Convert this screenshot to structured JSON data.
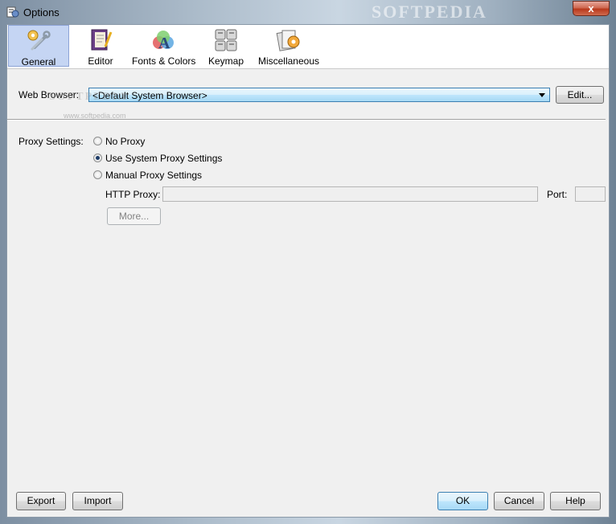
{
  "window": {
    "title": "Options",
    "close_label": "x",
    "watermark": "SOFTPEDIA",
    "watermark_url": "www.softpedia.com"
  },
  "toolbar": {
    "tabs": [
      {
        "label": "General",
        "icon": "general-icon",
        "selected": true
      },
      {
        "label": "Editor",
        "icon": "editor-icon",
        "selected": false
      },
      {
        "label": "Fonts & Colors",
        "icon": "fonts-colors-icon",
        "selected": false
      },
      {
        "label": "Keymap",
        "icon": "keymap-icon",
        "selected": false
      },
      {
        "label": "Miscellaneous",
        "icon": "miscellaneous-icon",
        "selected": false
      }
    ]
  },
  "general": {
    "web_browser_label": "Web Browser:",
    "web_browser_value": "<Default System Browser>",
    "edit_button": "Edit...",
    "proxy_label": "Proxy Settings:",
    "proxy_options": [
      {
        "label": "No Proxy",
        "selected": false
      },
      {
        "label": "Use System Proxy Settings",
        "selected": true
      },
      {
        "label": "Manual Proxy Settings",
        "selected": false
      }
    ],
    "http_proxy_label": "HTTP Proxy:",
    "http_proxy_value": "",
    "port_label": "Port:",
    "port_value": "",
    "more_button": "More..."
  },
  "footer": {
    "export": "Export",
    "import": "Import",
    "ok": "OK",
    "cancel": "Cancel",
    "help": "Help"
  },
  "colors": {
    "selected_tab_bg": "#c5d5f3",
    "panel_bg": "#f0f0f0",
    "close_red": "#c2432a"
  }
}
